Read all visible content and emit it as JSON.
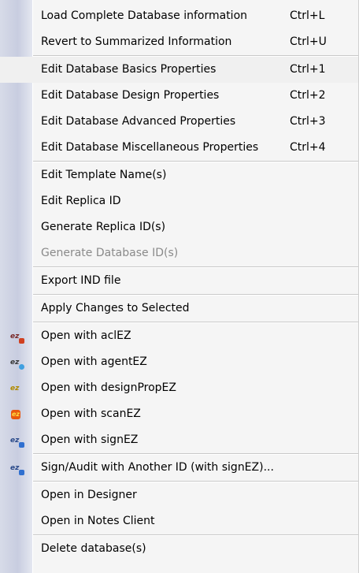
{
  "menu": {
    "items": [
      {
        "label": "Load Complete Database information",
        "shortcut": "Ctrl+L"
      },
      {
        "label": "Revert to Summarized Information",
        "shortcut": "Ctrl+U"
      },
      {
        "label": "Edit Database Basics Properties",
        "shortcut": "Ctrl+1"
      },
      {
        "label": "Edit Database Design Properties",
        "shortcut": "Ctrl+2"
      },
      {
        "label": "Edit Database Advanced Properties",
        "shortcut": "Ctrl+3"
      },
      {
        "label": "Edit Database Miscellaneous Properties",
        "shortcut": "Ctrl+4"
      },
      {
        "label": "Edit Template Name(s)"
      },
      {
        "label": "Edit Replica ID"
      },
      {
        "label": "Generate Replica ID(s)"
      },
      {
        "label": "Generate Database ID(s)"
      },
      {
        "label": "Export IND file"
      },
      {
        "label": "Apply Changes to Selected"
      },
      {
        "label": "Open with aclEZ",
        "icon": "aclez-icon"
      },
      {
        "label": "Open with agentEZ",
        "icon": "agentez-icon"
      },
      {
        "label": "Open with designPropEZ",
        "icon": "designpropez-icon"
      },
      {
        "label": "Open with scanEZ",
        "icon": "scanez-icon"
      },
      {
        "label": "Open with signEZ",
        "icon": "signez-icon"
      },
      {
        "label": "Sign/Audit with Another ID (with signEZ)...",
        "icon": "signez-icon"
      },
      {
        "label": "Open in Designer"
      },
      {
        "label": "Open in Notes Client"
      },
      {
        "label": "Delete database(s)"
      }
    ],
    "icon_text": {
      "ez": "ez"
    },
    "colors": {
      "background": "#f5f5f5",
      "gutter": "#c8cde0",
      "disabled_text": "#8a8a8a"
    }
  }
}
